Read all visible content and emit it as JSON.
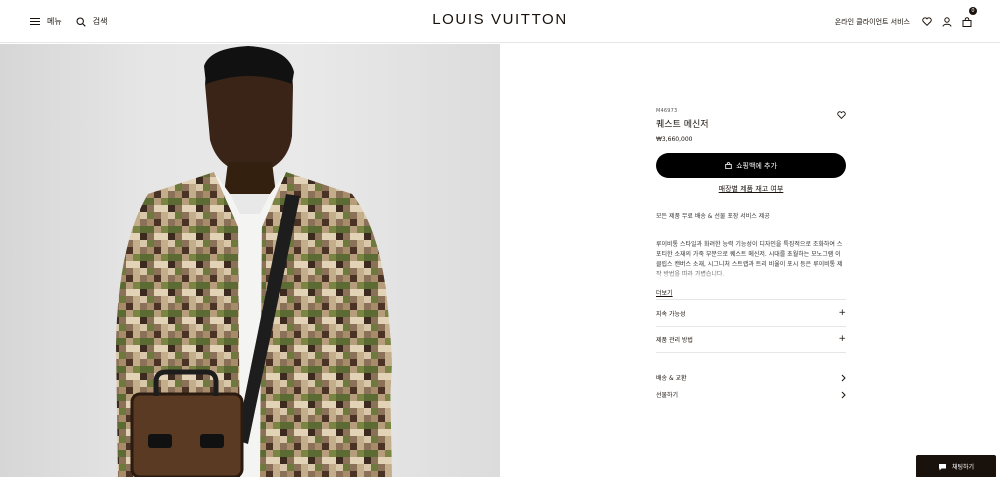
{
  "header": {
    "menu_label": "메뉴",
    "search_label": "검색",
    "logo": "LOUIS VUITTON",
    "service_label": "온라인 클라이언트 서비스",
    "cart_count": "0"
  },
  "product": {
    "sku": "M46973",
    "name": "퀘스트 메신저",
    "price": "₩3,660,000",
    "add_to_cart": "쇼핑백에 추가",
    "store_availability": "매장별 제품 재고 여부",
    "shipping_note": "모든 제품 무료 배송 & 선물 포장 서비스 제공",
    "description": "루이비통 스타일과 화려한 능력 기능성이 디자인을 특징적으로 조화하여 스포티한 소재의 가죽 부분으로 퀘스트 메신저. 시대를 초월하는 모노그램 이클립스 캔버스 소재, 시그니처 스트랩과 트리 비율이 포시 등은 루이비통 제작 방법을 따라 가볍습니다.",
    "more_label": "더보기"
  },
  "accordions": [
    {
      "label": "지속 가능성"
    },
    {
      "label": "제품 관리 방법"
    }
  ],
  "links": [
    {
      "label": "배송 & 교환"
    },
    {
      "label": "선물하기"
    }
  ],
  "chat": {
    "label": "채팅하기"
  }
}
